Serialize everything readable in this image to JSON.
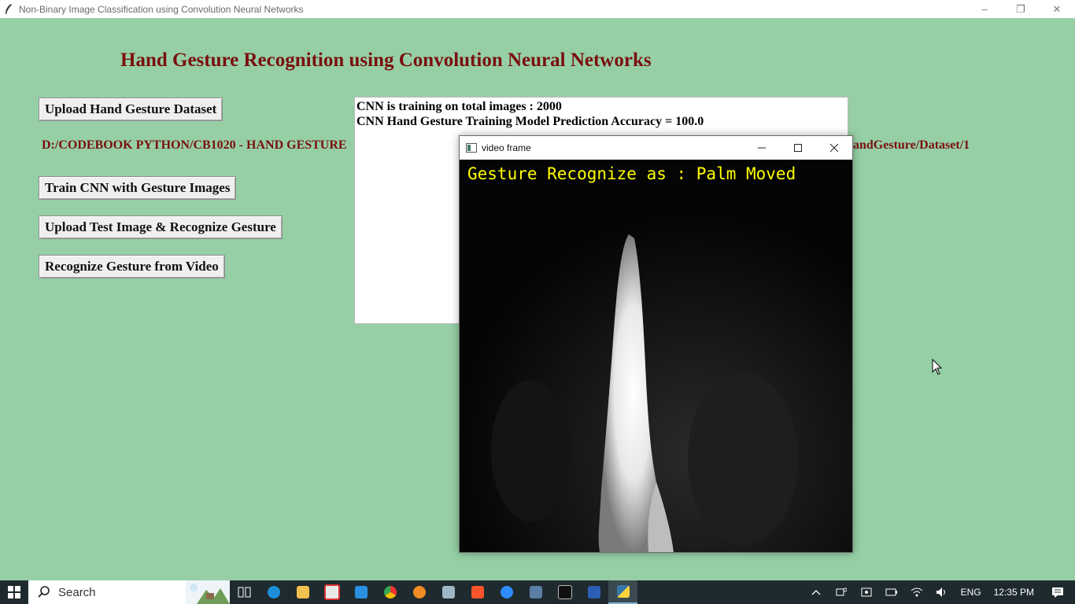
{
  "window": {
    "title": "Non-Binary Image Classification using Convolution Neural Networks",
    "controls": {
      "minimize": "–",
      "restore": "❐",
      "close": "✕"
    }
  },
  "app": {
    "heading": "Hand Gesture Recognition using Convolution Neural Networks",
    "buttons": {
      "upload_dataset": "Upload Hand Gesture Dataset",
      "train_cnn": "Train CNN with Gesture Images",
      "upload_test": "Upload Test Image & Recognize Gesture",
      "recognize_video": "Recognize Gesture from Video"
    },
    "path_label_left": "D:/CODEBOOK PYTHON/CB1020 - HAND GESTURE",
    "path_label_right": "andGesture/Dataset/1",
    "output_lines": [
      "CNN is training on total images : 2000",
      "CNN Hand Gesture Training Model Prediction Accuracy = 100.0"
    ]
  },
  "video_window": {
    "title": "video frame",
    "overlay_text": "Gesture Recognize as : Palm Moved",
    "overlay_color": "#ffff00"
  },
  "taskbar": {
    "search_placeholder": "Search",
    "language": "ENG",
    "time": "12:35 PM",
    "pinned_icons": [
      "task-view-icon",
      "edge-icon",
      "file-explorer-icon",
      "app-red-icon",
      "vscode-icon",
      "chrome-icon",
      "search-app-icon",
      "screen-tool-icon",
      "brave-icon",
      "zoom-icon",
      "remote-icon",
      "cmd-icon",
      "word-icon",
      "python-icon"
    ]
  },
  "colors": {
    "background": "#96cfa6",
    "heading": "#7a0f0f",
    "taskbar": "#1f2a2e"
  }
}
